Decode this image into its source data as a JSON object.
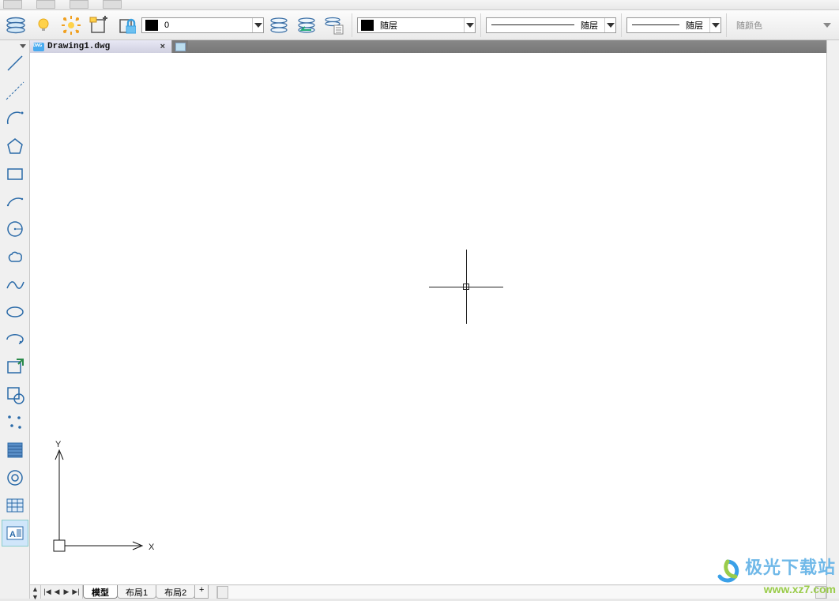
{
  "toolbar": {
    "layer_value": "0",
    "linetype_color_label": "随层",
    "linetype_label": "随层",
    "lineweight_label": "随层",
    "plotstyle_label": "随颜色"
  },
  "file_tab": {
    "name": "Drawing1.dwg",
    "close_glyph": "×"
  },
  "ucs": {
    "x_label": "X",
    "y_label": "Y"
  },
  "layouts": {
    "model": "模型",
    "layout1": "布局1",
    "layout2": "布局2",
    "add": "+"
  },
  "nav": {
    "up": "▲",
    "down": "▼",
    "first": "|◀",
    "prev": "◀",
    "next": "▶",
    "last": "▶|"
  },
  "watermark": {
    "brand": "极光下载站",
    "url": "www.xz7.com"
  }
}
